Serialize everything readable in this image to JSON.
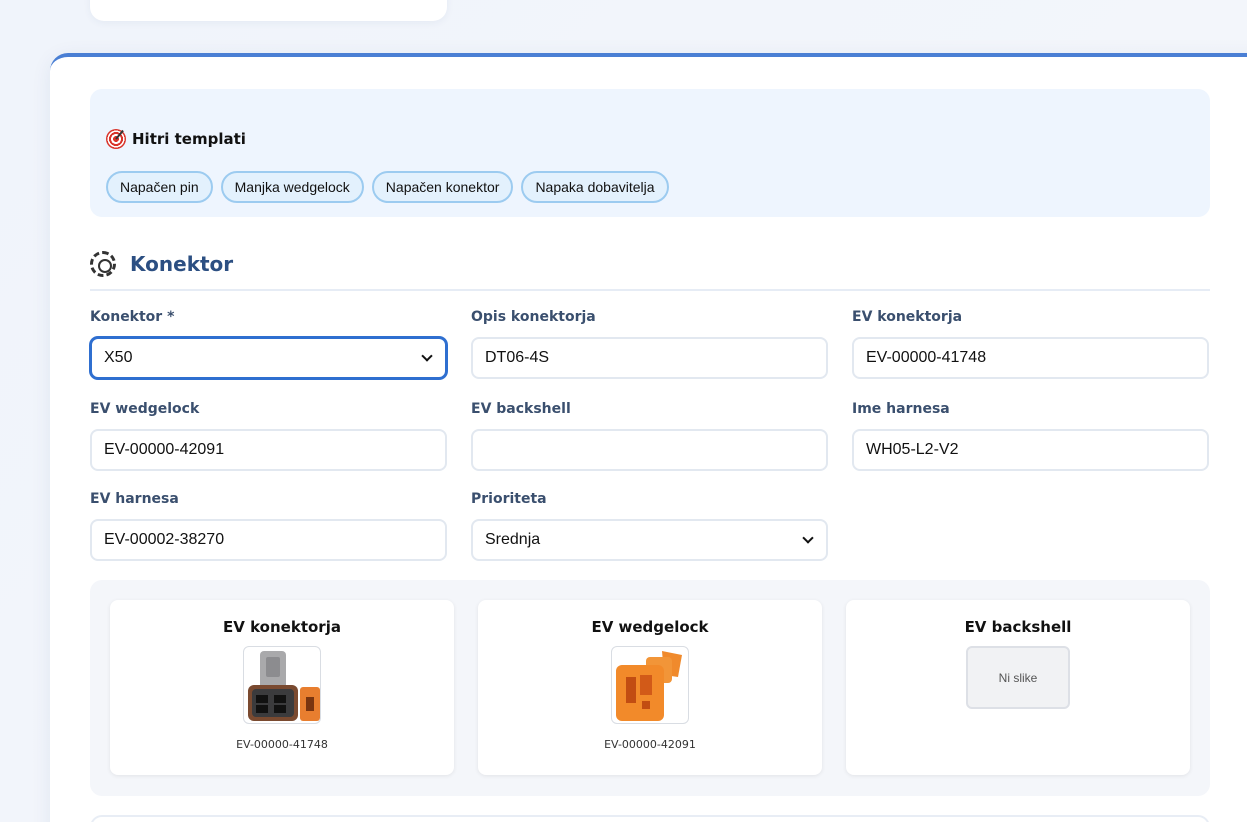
{
  "templates": {
    "title": "Hitri templati",
    "chips": [
      "Napačen pin",
      "Manjka wedgelock",
      "Napačen konektor",
      "Napaka dobavitelja"
    ]
  },
  "section": {
    "title": "Konektor"
  },
  "fields": {
    "konektor": {
      "label": "Konektor *",
      "value": "X50"
    },
    "opis": {
      "label": "Opis konektorja",
      "value": "DT06-4S"
    },
    "ev_konektorja": {
      "label": "EV konektorja",
      "value": "EV-00000-41748"
    },
    "ev_wedgelock": {
      "label": "EV wedgelock",
      "value": "EV-00000-42091"
    },
    "ev_backshell": {
      "label": "EV backshell",
      "value": ""
    },
    "ime_harnesa": {
      "label": "Ime harnesa",
      "value": "WH05-L2-V2"
    },
    "ev_harnesa": {
      "label": "EV harnesa",
      "value": "EV-00002-38270"
    },
    "prioriteta": {
      "label": "Prioriteta",
      "value": "Srednja"
    }
  },
  "images": {
    "konektor": {
      "title": "EV konektorja",
      "code": "EV-00000-41748"
    },
    "wedgelock": {
      "title": "EV wedgelock",
      "code": "EV-00000-42091"
    },
    "backshell": {
      "title": "EV backshell",
      "placeholder": "Ni slike"
    }
  }
}
